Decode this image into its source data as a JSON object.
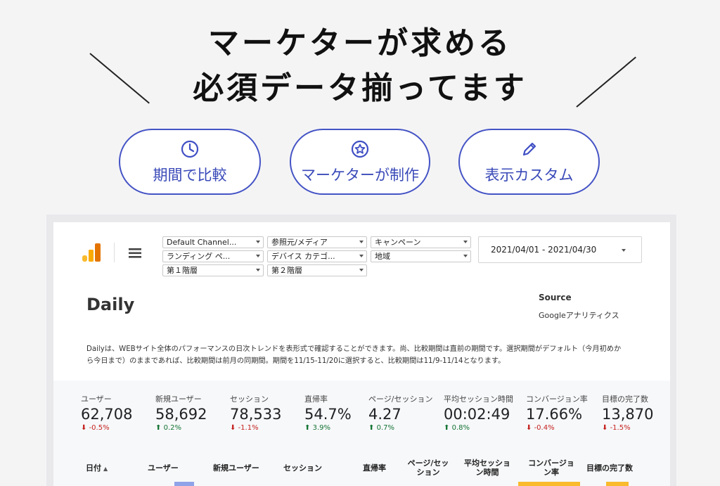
{
  "headline": {
    "line1": "マーケターが求める",
    "line2": "必須データ揃ってます"
  },
  "features": [
    {
      "icon": "clock-icon",
      "label": "期間で比較"
    },
    {
      "icon": "star-circle-icon",
      "label": "マーケターが制作"
    },
    {
      "icon": "pencil-icon",
      "label": "表示カスタム"
    }
  ],
  "filters": {
    "channel": "Default Channel...",
    "source_medium": "参照元/メディア",
    "campaign": "キャンペーン",
    "landing": "ランディング ペ...",
    "device": "デバイス カテゴ...",
    "region": "地域",
    "level1": "第１階層",
    "level2": "第２階層"
  },
  "date_range": "2021/04/01 - 2021/04/30",
  "report": {
    "title": "Daily",
    "source_label": "Source",
    "source_value": "Googleアナリティクス",
    "description": "Dailyは、WEBサイト全体のパフォーマンスの日次トレンドを表形式で確認することができます。尚、比較期間は直前の期間です。選択期間がデフォルト（今月初めから今日まで）のままであれば、比較期間は前月の同期間。期間を11/15-11/20に選択すると、比較期間は11/9-11/14となります。"
  },
  "metrics": [
    {
      "label": "ユーザー",
      "value": "62,708",
      "delta": "-0.5%",
      "direction": "down"
    },
    {
      "label": "新規ユーザー",
      "value": "58,692",
      "delta": "0.2%",
      "direction": "up"
    },
    {
      "label": "セッション",
      "value": "78,533",
      "delta": "-1.1%",
      "direction": "down"
    },
    {
      "label": "直帰率",
      "value": "54.7%",
      "delta": "3.9%",
      "direction": "up"
    },
    {
      "label": "ページ/セッション",
      "value": "4.27",
      "delta": "0.7%",
      "direction": "up"
    },
    {
      "label": "平均セッション時間",
      "value": "00:02:49",
      "delta": "0.8%",
      "direction": "up"
    },
    {
      "label": "コンバージョン率",
      "value": "17.66%",
      "delta": "-0.4%",
      "direction": "down"
    },
    {
      "label": "目標の完了数",
      "value": "13,870",
      "delta": "-1.5%",
      "direction": "down"
    }
  ],
  "table": {
    "headers": {
      "date": "日付",
      "users": "ユーザー",
      "new_users": "新規ユーザー",
      "sessions": "セッション",
      "bounce": "直帰率",
      "pages_l1": "ページ/セッ",
      "pages_l2": "ション",
      "duration_l1": "平均セッショ",
      "duration_l2": "ン時間",
      "conv_l1": "コンバージョ",
      "conv_l2": "ン率",
      "goals": "目標の完了数"
    }
  },
  "colors": {
    "accent_blue": "#4453c5",
    "positive": "#137333",
    "negative": "#c5221f",
    "highlight_yellow": "#f9bb2d",
    "bar_blue": "#8fa3e8"
  }
}
